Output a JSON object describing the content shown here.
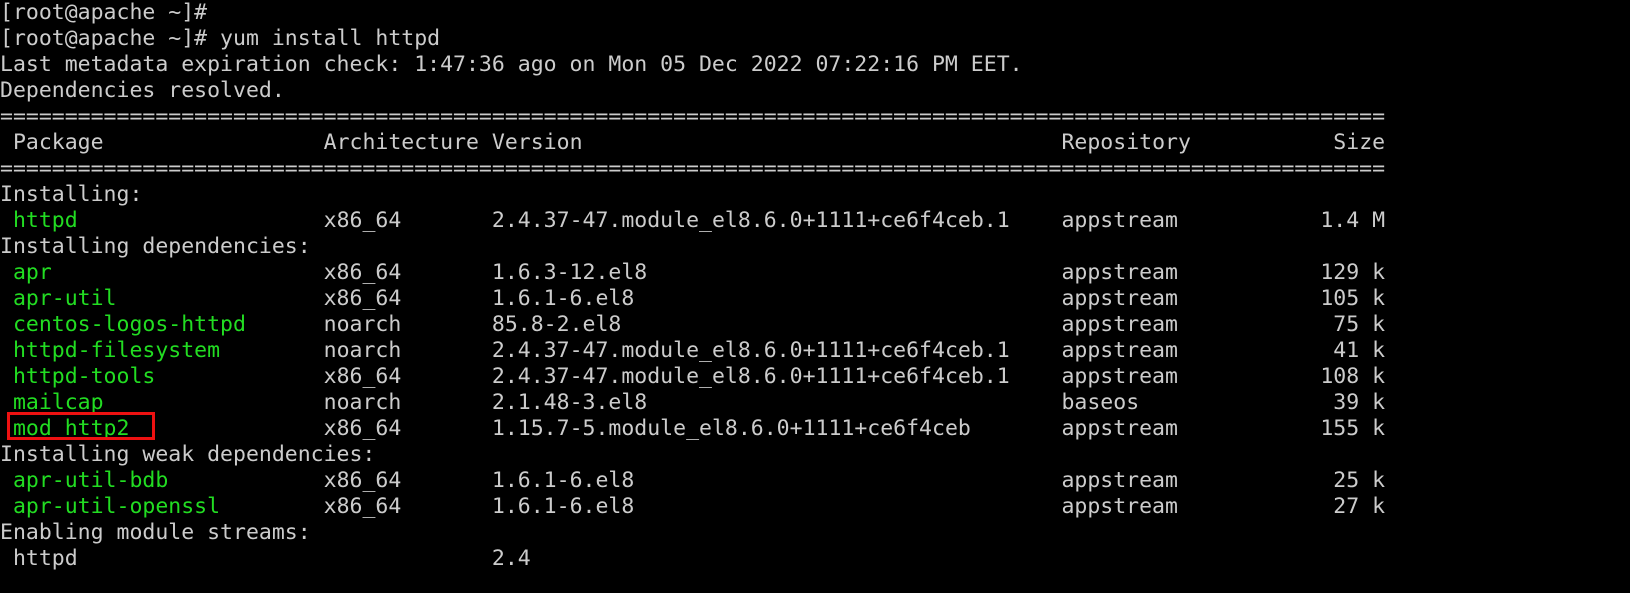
{
  "terminal": {
    "prompt": "[root@apache ~]#",
    "command": "yum install httpd",
    "prompt_line_1": "[root@apache ~]#",
    "prompt_line_2": "[root@apache ~]# yum install httpd",
    "metadata_line": "Last metadata expiration check: 1:47:36 ago on Mon 05 Dec 2022 07:22:16 PM EET.",
    "resolved_line": "Dependencies resolved.",
    "separator_char": "=",
    "separator_count": 107,
    "colors": {
      "background": "#000000",
      "foreground": "#cccccc",
      "package_green": "#22dd22",
      "highlight_red": "#ee1111"
    }
  },
  "table": {
    "headers": {
      "package": "Package",
      "architecture": "Architecture",
      "version": "Version",
      "repository": "Repository",
      "size": "Size"
    },
    "column_starts": {
      "package": 1,
      "architecture": 25,
      "version": 38,
      "repository": 82,
      "size_end": 107
    },
    "sections": [
      {
        "label": "Installing:",
        "rows": [
          {
            "package": "httpd",
            "architecture": "x86_64",
            "version": "2.4.37-47.module_el8.6.0+1111+ce6f4ceb.1",
            "repository": "appstream",
            "size": "1.4 M",
            "highlighted": false
          }
        ]
      },
      {
        "label": "Installing dependencies:",
        "rows": [
          {
            "package": "apr",
            "architecture": "x86_64",
            "version": "1.6.3-12.el8",
            "repository": "appstream",
            "size": "129 k",
            "highlighted": false
          },
          {
            "package": "apr-util",
            "architecture": "x86_64",
            "version": "1.6.1-6.el8",
            "repository": "appstream",
            "size": "105 k",
            "highlighted": false
          },
          {
            "package": "centos-logos-httpd",
            "architecture": "noarch",
            "version": "85.8-2.el8",
            "repository": "appstream",
            "size": "75 k",
            "highlighted": false
          },
          {
            "package": "httpd-filesystem",
            "architecture": "noarch",
            "version": "2.4.37-47.module_el8.6.0+1111+ce6f4ceb.1",
            "repository": "appstream",
            "size": "41 k",
            "highlighted": false
          },
          {
            "package": "httpd-tools",
            "architecture": "x86_64",
            "version": "2.4.37-47.module_el8.6.0+1111+ce6f4ceb.1",
            "repository": "appstream",
            "size": "108 k",
            "highlighted": false
          },
          {
            "package": "mailcap",
            "architecture": "noarch",
            "version": "2.1.48-3.el8",
            "repository": "baseos",
            "size": "39 k",
            "highlighted": false
          },
          {
            "package": "mod_http2",
            "architecture": "x86_64",
            "version": "1.15.7-5.module_el8.6.0+1111+ce6f4ceb",
            "repository": "appstream",
            "size": "155 k",
            "highlighted": true
          }
        ]
      },
      {
        "label": "Installing weak dependencies:",
        "rows": [
          {
            "package": "apr-util-bdb",
            "architecture": "x86_64",
            "version": "1.6.1-6.el8",
            "repository": "appstream",
            "size": "25 k",
            "highlighted": false
          },
          {
            "package": "apr-util-openssl",
            "architecture": "x86_64",
            "version": "1.6.1-6.el8",
            "repository": "appstream",
            "size": "27 k",
            "highlighted": false
          }
        ]
      },
      {
        "label": "Enabling module streams:",
        "rows": [
          {
            "package": "httpd",
            "architecture": "",
            "version": "2.4",
            "repository": "",
            "size": "",
            "highlighted": false,
            "plain": true
          }
        ]
      }
    ]
  }
}
